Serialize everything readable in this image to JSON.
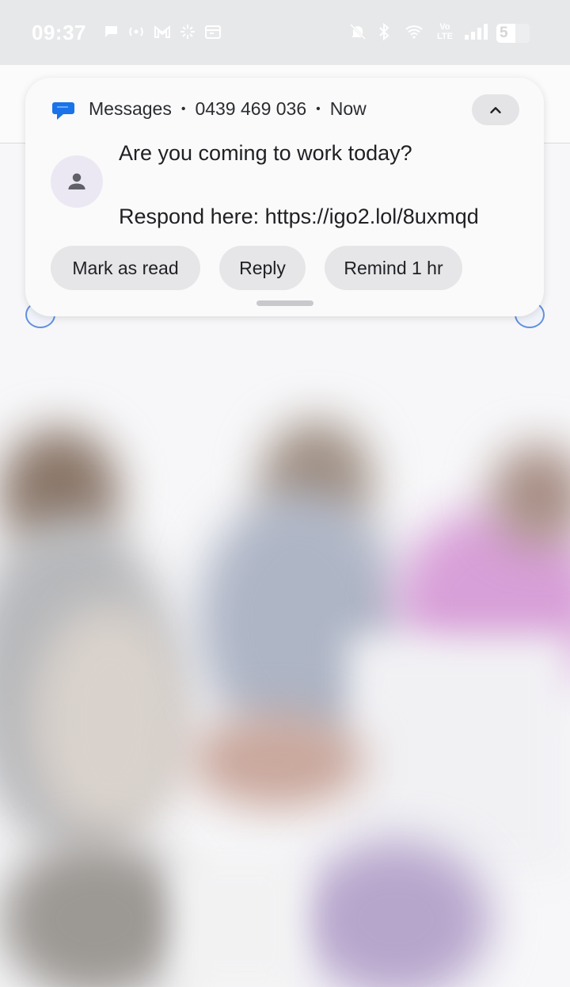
{
  "status_bar": {
    "time": "09:37",
    "battery": "5",
    "network_label": "Vo LTE"
  },
  "notification": {
    "app_name": "Messages",
    "sender": "0439 469 036",
    "time": "Now",
    "message_line1": "Are you coming to work today?",
    "message_line2": "Respond here: https://igo2.lol/8uxmqd",
    "actions": [
      {
        "label": "Mark as read"
      },
      {
        "label": "Reply"
      },
      {
        "label": "Remind 1 hr"
      }
    ]
  },
  "colors": {
    "app_accent": "#1a73e8",
    "card_bg": "#fafafa",
    "button_bg": "#e6e6e8"
  },
  "icons": [
    "messages-app-icon",
    "chevron-up-icon",
    "person-avatar-icon",
    "chat-bubble-icon",
    "wifi-icon",
    "bluetooth-icon",
    "mute-icon",
    "signal-icon",
    "battery-icon",
    "gmail-icon",
    "calendar-icon"
  ]
}
